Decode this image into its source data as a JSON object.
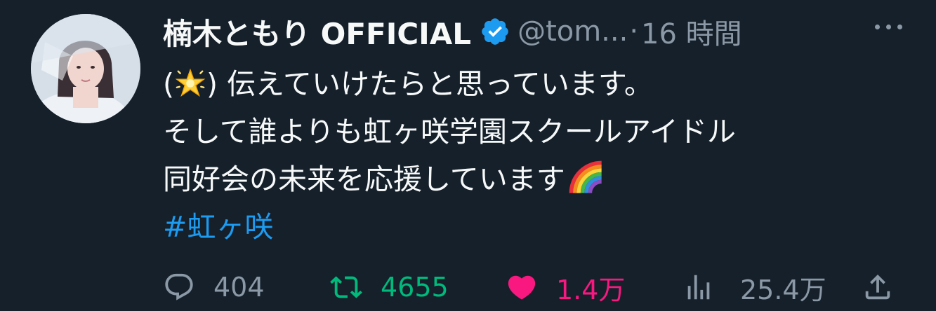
{
  "tweet": {
    "author": {
      "display_name": "楠木ともり OFFICIAL",
      "handle": "@tom...",
      "separator": "·",
      "time": "16 時間",
      "verified_color": "#1d9bf0"
    },
    "text_lines": [
      {
        "prefix": "(",
        "emoji": "glowing-star-emoji",
        "suffix": ")",
        "text": " 伝えていけたらと思っています。"
      },
      {
        "text": "そして誰よりも虹ヶ咲学園スクールアイドル"
      },
      {
        "text": "同好会の未来を応援しています",
        "emoji": "rainbow-emoji"
      }
    ],
    "hashtag": "#虹ヶ咲",
    "actions": {
      "reply_count": "404",
      "retweet_count": "4655",
      "like_count": "1.4万",
      "view_count": "25.4万"
    }
  },
  "colors": {
    "background": "#15202b",
    "text": "#f7f9f9",
    "muted": "#8b98a5",
    "link": "#1d9bf0",
    "retweet": "#00ba7c",
    "like": "#f91880"
  }
}
